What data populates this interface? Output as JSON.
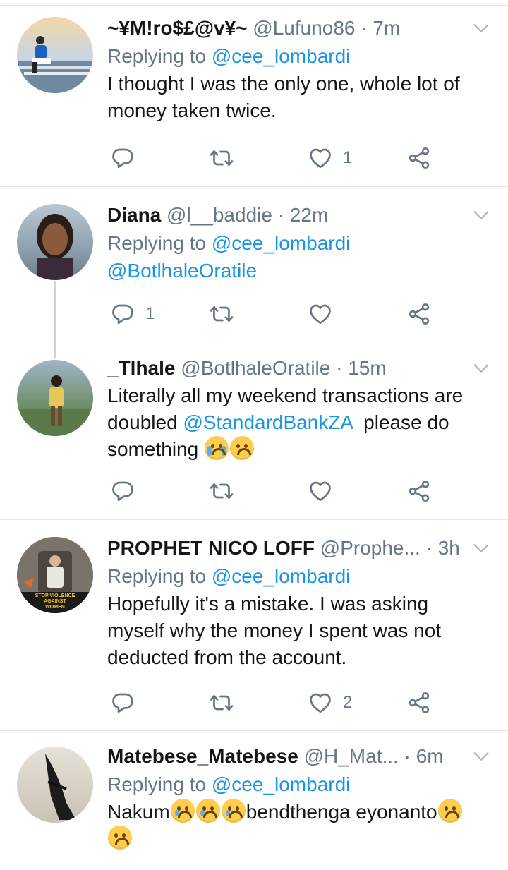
{
  "tweets": [
    {
      "name": "~¥M!ro$£@v¥~",
      "handle": "@Lufuno86",
      "time": "7m",
      "replying_prefix": "Replying to ",
      "replying_to": "@cee_lombardi",
      "text_line1": "I thought I was the only one, whole lot of",
      "text_line2": "money taken twice.",
      "reply_count": "",
      "retweet_count": "",
      "like_count": "1"
    },
    {
      "name": "Diana",
      "handle": "@l__baddie",
      "time": "22m",
      "replying_prefix": "Replying to ",
      "replying_to": "@cee_lombardi",
      "mention_line": "@BotlhaleOratile",
      "reply_count": "1",
      "retweet_count": "",
      "like_count": ""
    },
    {
      "name": "_Tlhale",
      "handle": "@BotlhaleOratile",
      "time": "15m",
      "text_line1": "Literally all my weekend transactions are",
      "text_line2_a": "doubled ",
      "text_line2_mention": "@StandardBankZA",
      "text_line2_b": "  please do",
      "text_line3": "something ",
      "reply_count": "",
      "retweet_count": "",
      "like_count": ""
    },
    {
      "name": "PROPHET NICO LOFF",
      "handle": "@Prophe...",
      "time": "3h",
      "replying_prefix": "Replying to ",
      "replying_to": "@cee_lombardi",
      "text_line1": "Hopefully it's a mistake. I was asking",
      "text_line2": "myself why the money I spent was not",
      "text_line3": "deducted from the account.",
      "avatar_badge_text": "STOP VIOLENCE AGAINST WOMEN",
      "reply_count": "",
      "retweet_count": "",
      "like_count": "2"
    },
    {
      "name": "Matebese_Matebese",
      "handle": "@H_Mat...",
      "time": "6m",
      "replying_prefix": "Replying to ",
      "replying_to": "@cee_lombardi",
      "text_a": "Nakum",
      "text_b": "bendthenga eyonanto",
      "reply_count": "",
      "retweet_count": "",
      "like_count": ""
    }
  ],
  "icons": {
    "reply": "reply-icon",
    "retweet": "retweet-icon",
    "like": "heart-icon",
    "share": "share-icon",
    "caret": "chevron-down-icon"
  },
  "colors": {
    "link": "#1b95e0",
    "muted": "#657786",
    "divider": "#e1e8ed",
    "thread_line": "#ccd6dd"
  }
}
